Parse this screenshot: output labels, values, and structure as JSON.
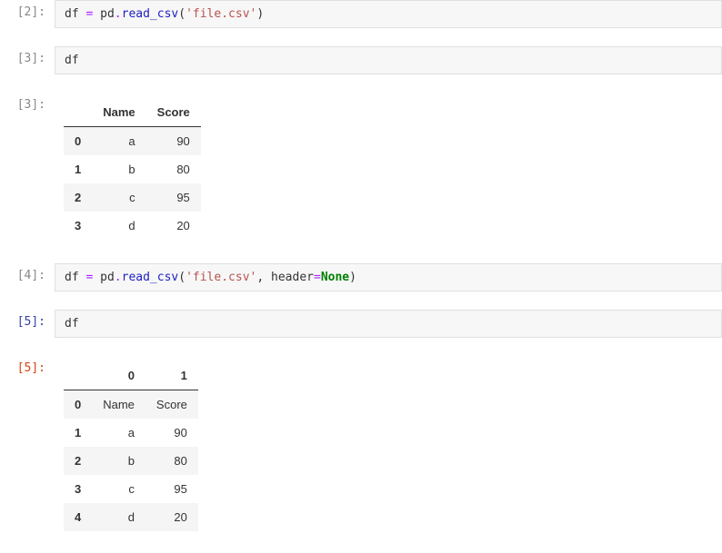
{
  "cells": {
    "c2": {
      "prompt": "[2]:",
      "code_tokens": [
        {
          "t": "df "
        },
        {
          "t": "=",
          "c": "tok-eq"
        },
        {
          "t": " pd"
        },
        {
          "t": ".",
          "c": "tok-eq"
        },
        {
          "t": "read_csv",
          "c": "tok-call"
        },
        {
          "t": "(",
          "c": "tok-paren"
        },
        {
          "t": "'file.csv'",
          "c": "tok-str"
        },
        {
          "t": ")",
          "c": "tok-paren"
        }
      ]
    },
    "c3_in": {
      "prompt": "[3]:",
      "code_tokens": [
        {
          "t": "df"
        }
      ]
    },
    "c3_out": {
      "prompt": "[3]:",
      "columns": [
        "",
        "Name",
        "Score"
      ],
      "rows": [
        {
          "idx": "0",
          "vals": [
            "a",
            "90"
          ]
        },
        {
          "idx": "1",
          "vals": [
            "b",
            "80"
          ]
        },
        {
          "idx": "2",
          "vals": [
            "c",
            "95"
          ]
        },
        {
          "idx": "3",
          "vals": [
            "d",
            "20"
          ]
        }
      ]
    },
    "c4": {
      "prompt": "[4]:",
      "code_tokens": [
        {
          "t": "df "
        },
        {
          "t": "=",
          "c": "tok-eq"
        },
        {
          "t": " pd"
        },
        {
          "t": ".",
          "c": "tok-eq"
        },
        {
          "t": "read_csv",
          "c": "tok-call"
        },
        {
          "t": "(",
          "c": "tok-paren"
        },
        {
          "t": "'file.csv'",
          "c": "tok-str"
        },
        {
          "t": ", header"
        },
        {
          "t": "=",
          "c": "tok-eq"
        },
        {
          "t": "None",
          "c": "tok-kw"
        },
        {
          "t": ")",
          "c": "tok-paren"
        }
      ]
    },
    "c5_in": {
      "prompt": "[5]:",
      "code_tokens": [
        {
          "t": "df"
        }
      ]
    },
    "c5_out": {
      "prompt": "[5]:",
      "columns": [
        "",
        "0",
        "1"
      ],
      "rows": [
        {
          "idx": "0",
          "vals": [
            "Name",
            "Score"
          ]
        },
        {
          "idx": "1",
          "vals": [
            "a",
            "90"
          ]
        },
        {
          "idx": "2",
          "vals": [
            "b",
            "80"
          ]
        },
        {
          "idx": "3",
          "vals": [
            "c",
            "95"
          ]
        },
        {
          "idx": "4",
          "vals": [
            "d",
            "20"
          ]
        }
      ]
    }
  }
}
